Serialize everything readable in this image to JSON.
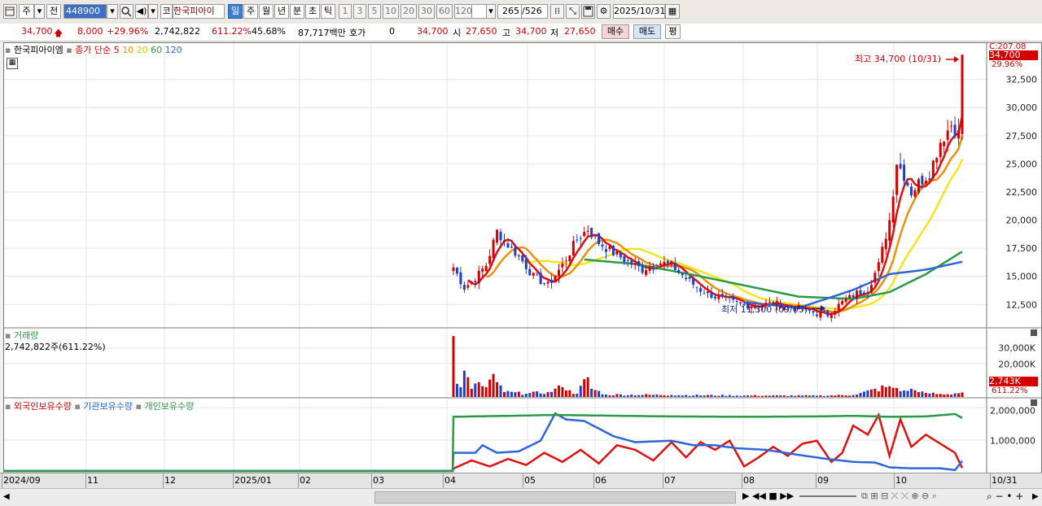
{
  "toolbar": {
    "market": "주",
    "prev": "전",
    "code": "448900",
    "type_prefix": "코",
    "stock_name": "한국피아이",
    "periods": [
      "일",
      "주",
      "월",
      "년",
      "분",
      "초",
      "틱"
    ],
    "active_period": "일",
    "intervals": [
      "1",
      "3",
      "5",
      "10",
      "20",
      "30",
      "60",
      "120"
    ],
    "count": "265",
    "total": "/526",
    "date": "2025/10/31"
  },
  "quote": {
    "price": "34,700",
    "change": "8,000",
    "change_pct": "+29.96%",
    "volume": "2,742,822",
    "volume_ratio": "611.22%",
    "turnover": "45.68%",
    "amount": "87,717백만",
    "hoga_label": "호가",
    "hoga_value": "0",
    "ask": "34,700",
    "open_label": "시",
    "open": "27,650",
    "high_label": "고",
    "high": "34,700",
    "low_label": "저",
    "low": "27,650",
    "buy": "매수",
    "sell": "매도",
    "eval": "평"
  },
  "colors": {
    "up": "#d40000",
    "down": "#1c3fd0",
    "ma5": "#e01010",
    "ma10": "#e8920a",
    "ma20": "#f2e620",
    "ma60": "#2a9a46",
    "ma120": "#2e66d8",
    "foreign": "#e01010",
    "institution": "#2e66d8",
    "individual": "#2a9a46"
  },
  "chart_data": [
    {
      "type": "candlestick",
      "title": "한국피아이엠",
      "legend": [
        "종가 단순 5",
        "10",
        "20",
        "60",
        "120"
      ],
      "price_label": "C:207.08",
      "last_price": "34,700",
      "last_pct": "29.96%",
      "ylim": [
        10500,
        35800
      ],
      "yticks": [
        "12,500",
        "15,000",
        "17,500",
        "20,000",
        "22,500",
        "25,000",
        "27,500",
        "30,000",
        "32,500"
      ],
      "xlabels": [
        "2024/09",
        "11",
        "12",
        "2025/01",
        "02",
        "03",
        "04",
        "05",
        "06",
        "07",
        "08",
        "09",
        "10",
        "10/31"
      ],
      "annotations": {
        "high": "최고 34,700 (10/31)",
        "low": "최저 11,300 (09/05)"
      },
      "closes_keyframes": [
        [
          0,
          15800
        ],
        [
          3,
          14000
        ],
        [
          6,
          14800
        ],
        [
          9,
          16000
        ],
        [
          12,
          19000
        ],
        [
          15,
          17800
        ],
        [
          18,
          16800
        ],
        [
          22,
          15000
        ],
        [
          26,
          14200
        ],
        [
          30,
          16000
        ],
        [
          34,
          18300
        ],
        [
          37,
          19200
        ],
        [
          40,
          18000
        ],
        [
          44,
          17100
        ],
        [
          48,
          16300
        ],
        [
          52,
          15600
        ],
        [
          56,
          16300
        ],
        [
          60,
          16000
        ],
        [
          64,
          14800
        ],
        [
          68,
          13800
        ],
        [
          72,
          13200
        ],
        [
          76,
          12800
        ],
        [
          80,
          12400
        ],
        [
          84,
          12500
        ],
        [
          88,
          12600
        ],
        [
          92,
          12300
        ],
        [
          96,
          12100
        ],
        [
          100,
          11700
        ],
        [
          103,
          11600
        ],
        [
          107,
          12700
        ],
        [
          111,
          13500
        ],
        [
          114,
          13900
        ],
        [
          117,
          16000
        ],
        [
          120,
          20000
        ],
        [
          122,
          25200
        ],
        [
          124,
          24000
        ],
        [
          126,
          22500
        ],
        [
          128,
          23300
        ],
        [
          131,
          24200
        ],
        [
          134,
          27000
        ],
        [
          137,
          28500
        ],
        [
          139,
          27650
        ],
        [
          140,
          34700
        ]
      ],
      "ma60_keyframes": [
        [
          36,
          16500
        ],
        [
          50,
          16100
        ],
        [
          65,
          15200
        ],
        [
          80,
          14200
        ],
        [
          95,
          13200
        ],
        [
          110,
          13000
        ],
        [
          120,
          13600
        ],
        [
          130,
          15200
        ],
        [
          140,
          17200
        ]
      ],
      "ma120_keyframes": [
        [
          80,
          12700
        ],
        [
          95,
          12200
        ],
        [
          110,
          13800
        ],
        [
          120,
          15200
        ],
        [
          130,
          15600
        ],
        [
          140,
          16300
        ]
      ]
    },
    {
      "type": "bar",
      "title": "거래량",
      "value_label": "2,742,822주(611.22%)",
      "yticks": [
        "30,000K",
        "20,000K"
      ],
      "ylim": [
        0,
        40000
      ],
      "last_label": "2,743K",
      "last_pct": "611.22%",
      "units": "K shares",
      "values_keyframes": [
        [
          0,
          37000
        ],
        [
          1,
          8000
        ],
        [
          2,
          6000
        ],
        [
          3,
          16000
        ],
        [
          4,
          12000
        ],
        [
          5,
          5000
        ],
        [
          7,
          9000
        ],
        [
          9,
          6000
        ],
        [
          11,
          14000
        ],
        [
          12,
          9000
        ],
        [
          14,
          3000
        ],
        [
          20,
          2000
        ],
        [
          26,
          3000
        ],
        [
          30,
          6000
        ],
        [
          31,
          4000
        ],
        [
          34,
          2000
        ],
        [
          37,
          12000
        ],
        [
          38,
          5000
        ],
        [
          42,
          1500
        ],
        [
          60,
          1200
        ],
        [
          80,
          900
        ],
        [
          100,
          800
        ],
        [
          110,
          1200
        ],
        [
          120,
          6500
        ],
        [
          122,
          5500
        ],
        [
          124,
          4000
        ],
        [
          126,
          5000
        ],
        [
          128,
          3000
        ],
        [
          130,
          2500
        ],
        [
          135,
          1500
        ],
        [
          140,
          2743
        ]
      ]
    },
    {
      "type": "line",
      "title_series": [
        "외국인보유수량",
        "기관보유수량",
        "개인보유수량"
      ],
      "yticks": [
        "2,000,000",
        "1,000,000"
      ],
      "ylim": [
        0,
        2200000
      ],
      "series": [
        {
          "name": "외국인보유수량",
          "keyframes": [
            [
              0,
              80000
            ],
            [
              5,
              350000
            ],
            [
              10,
              150000
            ],
            [
              15,
              400000
            ],
            [
              20,
              200000
            ],
            [
              25,
              600000
            ],
            [
              30,
              300000
            ],
            [
              35,
              700000
            ],
            [
              40,
              250000
            ],
            [
              45,
              850000
            ],
            [
              50,
              700000
            ],
            [
              55,
              350000
            ],
            [
              60,
              950000
            ],
            [
              64,
              450000
            ],
            [
              68,
              950000
            ],
            [
              72,
              700000
            ],
            [
              76,
              1000000
            ],
            [
              80,
              150000
            ],
            [
              84,
              450000
            ],
            [
              88,
              800000
            ],
            [
              92,
              500000
            ],
            [
              96,
              900000
            ],
            [
              100,
              1000000
            ],
            [
              104,
              300000
            ],
            [
              107,
              600000
            ],
            [
              110,
              1500000
            ],
            [
              114,
              1200000
            ],
            [
              117,
              1850000
            ],
            [
              120,
              500000
            ],
            [
              123,
              1700000
            ],
            [
              126,
              800000
            ],
            [
              130,
              1200000
            ],
            [
              134,
              900000
            ],
            [
              138,
              600000
            ],
            [
              140,
              100000
            ]
          ]
        },
        {
          "name": "기관보유수량",
          "keyframes": [
            [
              0,
              600000
            ],
            [
              6,
              600000
            ],
            [
              8,
              850000
            ],
            [
              12,
              600000
            ],
            [
              18,
              650000
            ],
            [
              24,
              1000000
            ],
            [
              28,
              1900000
            ],
            [
              31,
              1700000
            ],
            [
              36,
              1650000
            ],
            [
              40,
              1400000
            ],
            [
              44,
              1150000
            ],
            [
              50,
              950000
            ],
            [
              60,
              1000000
            ],
            [
              66,
              850000
            ],
            [
              72,
              850000
            ],
            [
              78,
              750000
            ],
            [
              86,
              700000
            ],
            [
              94,
              550000
            ],
            [
              98,
              480000
            ],
            [
              104,
              380000
            ],
            [
              110,
              300000
            ],
            [
              116,
              280000
            ],
            [
              120,
              120000
            ],
            [
              126,
              90000
            ],
            [
              134,
              90000
            ],
            [
              138,
              30000
            ],
            [
              140,
              330000
            ]
          ]
        },
        {
          "name": "개인보유수량",
          "keyframes": [
            [
              0,
              1790000
            ],
            [
              10,
              1810000
            ],
            [
              20,
              1830000
            ],
            [
              28,
              1850000
            ],
            [
              40,
              1830000
            ],
            [
              60,
              1800000
            ],
            [
              80,
              1790000
            ],
            [
              100,
              1800000
            ],
            [
              110,
              1820000
            ],
            [
              120,
              1790000
            ],
            [
              130,
              1800000
            ],
            [
              138,
              1880000
            ],
            [
              140,
              1750000
            ]
          ]
        }
      ]
    }
  ],
  "scroll": {}
}
